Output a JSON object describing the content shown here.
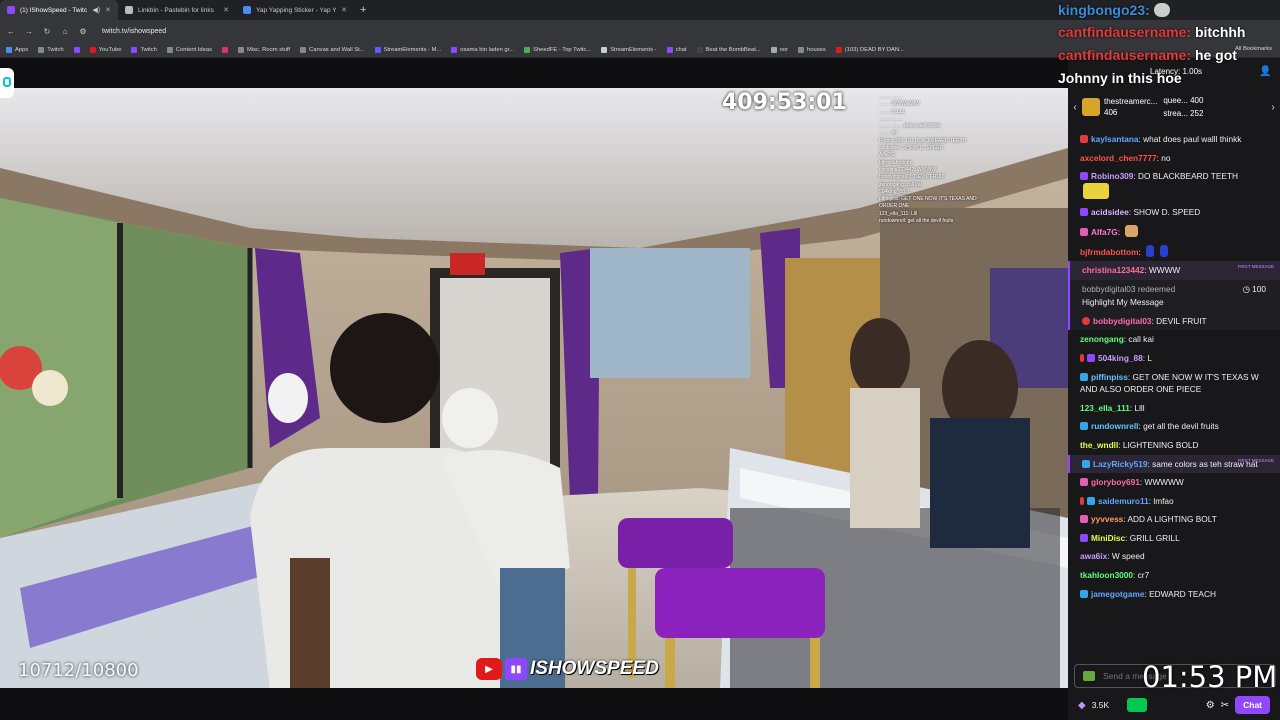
{
  "browser": {
    "tabs": [
      {
        "title": "(1) IShowSpeed - Twitch",
        "active": true,
        "color": "#9146ff"
      },
      {
        "title": "Linkbin - Pastebin for links",
        "active": false,
        "color": "#bbbbbb"
      },
      {
        "title": "Yap Yapping Sticker - Yap Yapp",
        "active": false,
        "color": "#4b8bf5"
      }
    ],
    "url": "twitch.tv/ishowspeed",
    "bookmarks": [
      "Apps",
      "Twitch",
      "YouTube",
      "Twitch",
      "Content Ideas",
      "",
      "Misc. Room stuff",
      "Canvas and Wall St...",
      "StreamElements - M...",
      "osama bin laden gr...",
      "SheedFE - Top Twitc...",
      "StreamElements -",
      "chat",
      "Beat the BombBeat...",
      "oor",
      "houses",
      "(103) DEAD BY DAN..."
    ],
    "all_bookmarks": "All Bookmarks"
  },
  "video": {
    "timer": "409:53:01",
    "counter": "10712/10800",
    "brand_name": "ISHOWSPEED",
    "clock": "01:53 PM",
    "mini_chat": [
      "........  ........ ",
      "........ WWWWWW",
      "........ LLLLL",
      "........ ........",
      "........ ........ does walll thinkk",
      "........ no",
      "Robino309: DO BLACKBEARD TEETH",
      "acidsidee: SHOW D. SPEED",
      "Alfa7G:",
      "bjfrmdabottom:",
      "christina123442: WWWW",
      "bobbydigital03: DEVIL FRUIT",
      "zenongang: call kai",
      "504king_88: L",
      "piffinpiss: GET ONE NOW  IT'S TEXAS AND",
      "ORDER ONE",
      "123_ella_111: Llll",
      "rundownrell: get all the devil fruits"
    ]
  },
  "overlay": {
    "lines": [
      {
        "user": "kingbongo23:",
        "msg": "",
        "user_color": "#3c8bd6"
      },
      {
        "user": "cantfindausername:",
        "msg": "bitchhh",
        "user_color": "#e03a3a"
      },
      {
        "user": "cantfindausername:",
        "msg": "he got",
        "user_color": "#e03a3a"
      },
      {
        "user": "",
        "msg": "Johnny in this hoe",
        "user_color": "#ffffff"
      }
    ],
    "latency": "Latency: 1.00s"
  },
  "chat": {
    "subs": {
      "main_name": "thestreamerc...",
      "main_count": "406",
      "side1_name": "quee...",
      "side1_count": "400",
      "side2_name": "strea...",
      "side2_count": "252"
    },
    "messages": [
      {
        "user": "kaylsantana",
        "text": "what does paul walll thinkk",
        "color": "#5fa8ff",
        "badge": "#e03a3a",
        "first": false
      },
      {
        "user": "axcelord_chen7777",
        "text": "no",
        "color": "#ff4f4f",
        "badge": "",
        "first": false
      },
      {
        "user": "Robino309",
        "text": "DO BLACKBEARD TEETH",
        "color": "#c99bff",
        "badge": "#9147ff",
        "first": false
      },
      {
        "user": "acidsidee",
        "text": "SHOW D. SPEED",
        "color": "#d6b3ff",
        "badge": "#9147ff",
        "first": false
      },
      {
        "user": "Alfa7G",
        "text": "",
        "color": "#ff7ad9",
        "badge": "#e05fb0",
        "first": false
      },
      {
        "user": "bjfrmdabottom",
        "text": "",
        "color": "#ff5050",
        "badge": "",
        "first": false
      },
      {
        "user": "christina123442",
        "text": "WWWW",
        "color": "#ff6f9a",
        "badge": "",
        "first": true,
        "tag": "FIRST MESSAGE"
      }
    ],
    "redeem": {
      "user": "bobbydigital03",
      "action": "redeemed",
      "reward": "Highlight My Message",
      "points": "100"
    },
    "messages2": [
      {
        "user": "bobbydigital03",
        "text": "DEVIL FRUIT",
        "color": "#ff6ba8",
        "badge": "#e03a3a",
        "first": false
      },
      {
        "user": "zenongang",
        "text": "call kai",
        "color": "#5cff7a",
        "badge": "",
        "first": false
      },
      {
        "user": "504king_88",
        "text": "L",
        "color": "#c99bff",
        "badge": "#9147ff",
        "first": false
      },
      {
        "user": "piffinpiss",
        "text": "GET ONE NOW  W  IT'S TEXAS  W  AND ALSO ORDER ONE PIECE",
        "color": "#5fc9ff",
        "badge": "#35a6e8",
        "first": false
      },
      {
        "user": "123_ella_111",
        "text": "Llll",
        "color": "#5cff7a",
        "badge": "",
        "first": false
      },
      {
        "user": "rundownrell",
        "text": "get all the devil fruits",
        "color": "#5fc9ff",
        "badge": "#35a6e8",
        "first": false
      },
      {
        "user": "the_wndll",
        "text": "LIGHTENING BOLD",
        "color": "#e0ff4a",
        "badge": "",
        "first": false
      },
      {
        "user": "LazyRicky519",
        "text": "same colors as teh straw hat",
        "color": "#5fa8ff",
        "badge": "#35a6e8",
        "first": true,
        "tag": "FIRST MESSAGE"
      },
      {
        "user": "gloryboy691",
        "text": "WWWWW",
        "color": "#ff6ba8",
        "badge": "#e05fb0",
        "first": false
      },
      {
        "user": "saidemuro11",
        "text": "lmfao",
        "color": "#5fa8ff",
        "badge": "#35a6e8",
        "first": false
      },
      {
        "user": "yyvvess",
        "text": "ADD A LIGHTING BOLT",
        "color": "#ff9a5f",
        "badge": "#e05fb0",
        "first": false
      },
      {
        "user": "MiniDisc",
        "text": "GRILL GRILL",
        "color": "#e0ff4a",
        "badge": "#9147ff",
        "first": false
      },
      {
        "user": "awa6ix",
        "text": "W speed",
        "color": "#c99bff",
        "badge": "",
        "first": false
      },
      {
        "user": "tkahloon3000",
        "text": "cr7",
        "color": "#5cff7a",
        "badge": "",
        "first": false
      },
      {
        "user": "jamegotgame",
        "text": "EDWARD TEACH",
        "color": "#5fa8ff",
        "badge": "#35a6e8",
        "first": false
      }
    ],
    "input_placeholder": "Send a message",
    "points": "3.5K",
    "chat_button": "Chat"
  }
}
